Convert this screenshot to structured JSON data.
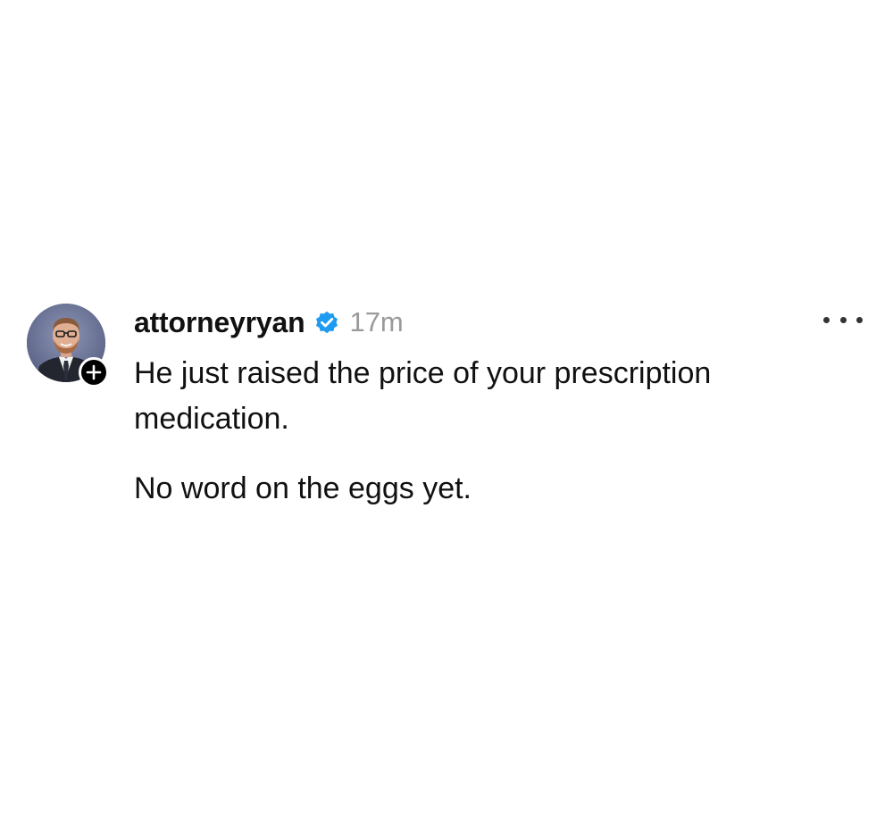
{
  "post": {
    "username": "attorneyryan",
    "verified": true,
    "timestamp": "17m",
    "paragraphs": [
      "He just raised the price of your prescription medication.",
      "No word on the eggs yet."
    ]
  },
  "icons": {
    "verified": "verified-badge-icon",
    "follow": "plus-icon",
    "more": "more-options-icon"
  },
  "colors": {
    "verified_blue": "#1d9bf0",
    "timestamp_gray": "#9a9a9a",
    "text": "#111111",
    "badge_black": "#000000"
  }
}
